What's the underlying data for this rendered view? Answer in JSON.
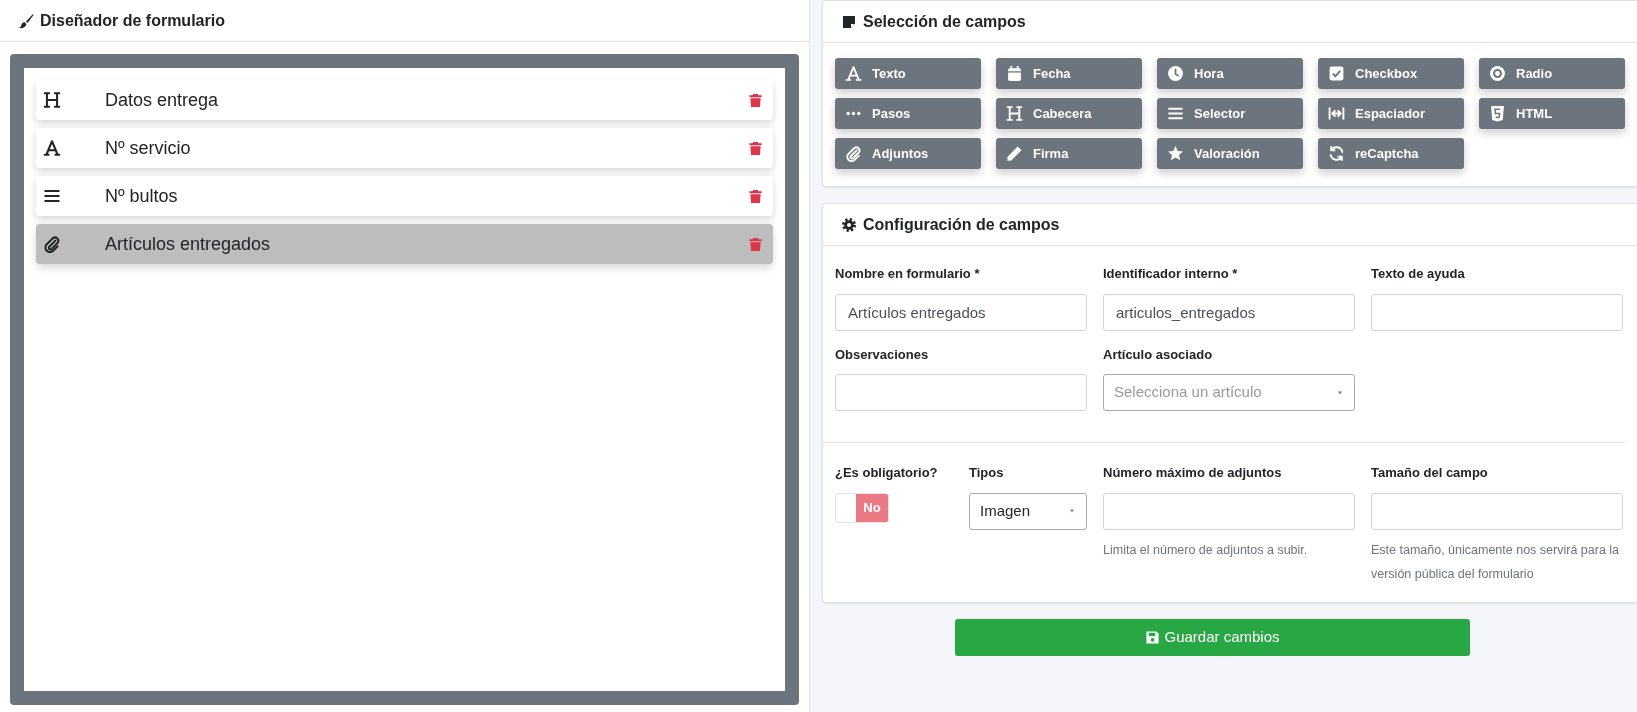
{
  "designer": {
    "title": "Diseñador de formulario",
    "fields": [
      {
        "kind": "heading",
        "label": "Datos entrega",
        "selected": false
      },
      {
        "kind": "font",
        "label": "Nº servicio",
        "selected": false
      },
      {
        "kind": "bars",
        "label": "Nº bultos",
        "selected": false
      },
      {
        "kind": "paperclip",
        "label": "Artículos entregados",
        "selected": true
      }
    ]
  },
  "field_picker": {
    "title": "Selección de campos",
    "buttons": [
      {
        "kind": "font",
        "label": "Texto"
      },
      {
        "kind": "calendar",
        "label": "Fecha"
      },
      {
        "kind": "clock",
        "label": "Hora"
      },
      {
        "kind": "checkbox",
        "label": "Checkbox"
      },
      {
        "kind": "radio",
        "label": "Radio"
      },
      {
        "kind": "dots",
        "label": "Pasos"
      },
      {
        "kind": "heading",
        "label": "Cabecera"
      },
      {
        "kind": "bars",
        "label": "Selector"
      },
      {
        "kind": "spacer",
        "label": "Espaciador"
      },
      {
        "kind": "html5",
        "label": "HTML"
      },
      {
        "kind": "paperclip",
        "label": "Adjuntos"
      },
      {
        "kind": "pencil",
        "label": "Firma"
      },
      {
        "kind": "star",
        "label": "Valoración"
      },
      {
        "kind": "sync",
        "label": "reCaptcha"
      }
    ]
  },
  "config": {
    "title": "Configuración de campos",
    "fields": [
      {
        "kind": "input",
        "label": "Nombre en formulario *",
        "value": "Artículos entregados"
      },
      {
        "kind": "input",
        "label": "Identificador interno *",
        "value": "articulos_entregados"
      },
      {
        "kind": "input",
        "label": "Texto de ayuda"
      },
      {
        "kind": "input",
        "label": "Observaciones"
      },
      {
        "kind": "select",
        "label": "Artículo asociado",
        "placeholder": "Selecciona un artículo"
      }
    ],
    "options": [
      {
        "kind": "toggle",
        "label": "¿Es obligatorio?",
        "on": false,
        "text": "No"
      },
      {
        "kind": "select",
        "label": "Tipos",
        "value": "Imagen"
      },
      {
        "kind": "input",
        "label": "Número máximo de adjuntos",
        "help": "Limita el número de adjuntos a subir."
      },
      {
        "kind": "input",
        "label": "Tamaño del campo",
        "help": "Este tamaño, únicamente nos servirá para la versión pública del formulario"
      }
    ]
  },
  "save_button": {
    "label": "Guardar cambios"
  }
}
